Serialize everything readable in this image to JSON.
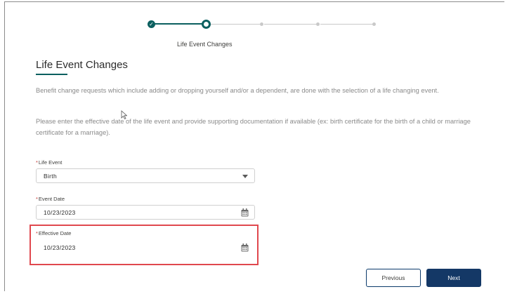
{
  "progress": {
    "current_step_label": "Life Event Changes",
    "done_check": "✓"
  },
  "page": {
    "title": "Life Event Changes",
    "paragraph1": "Benefit change requests which include adding or dropping yourself and/or a dependent, are done with the selection of a life changing event.",
    "paragraph2": "Please enter the effective date of the life event and provide supporting documentation if available (ex: birth certificate for the birth of a child or marriage certificate for a marriage)."
  },
  "form": {
    "required_marker": "*",
    "life_event": {
      "label": "Life Event",
      "value": "Birth"
    },
    "event_date": {
      "label": "Event Date",
      "value": "10/23/2023"
    },
    "effective_date": {
      "label": "Effective Date",
      "value": "10/23/2023"
    }
  },
  "buttons": {
    "previous": "Previous",
    "next": "Next"
  },
  "colors": {
    "progress_accent": "#0b5f5f",
    "highlight": "#e0484e",
    "primary_button": "#143866"
  },
  "icons": {
    "done_step": "check-circle-icon",
    "date_picker": "calendar-icon",
    "dropdown": "chevron-down-icon",
    "pointer": "mouse-cursor-icon"
  }
}
